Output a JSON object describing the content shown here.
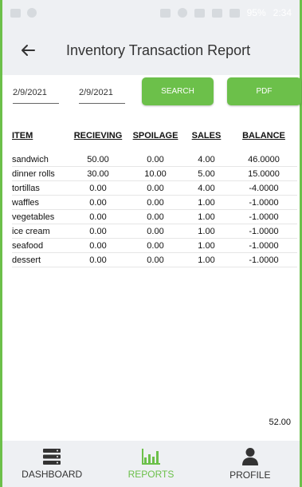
{
  "status_bar": {
    "battery": "95%",
    "time": "2:34"
  },
  "header": {
    "title": "Inventory Transaction Report"
  },
  "filters": {
    "date_from": "2/9/2021",
    "date_to": "2/9/2021",
    "search_label": "SEARCH",
    "pdf_label": "PDF"
  },
  "report": {
    "columns": [
      "ITEM",
      "RECIEVING",
      "SPOILAGE",
      "SALES",
      "BALANCE"
    ],
    "rows": [
      {
        "item": "sandwich",
        "recieving": "50.00",
        "spoilage": "0.00",
        "sales": "4.00",
        "balance": "46.0000"
      },
      {
        "item": "dinner rolls",
        "recieving": "30.00",
        "spoilage": "10.00",
        "sales": "5.00",
        "balance": "15.0000"
      },
      {
        "item": "tortillas",
        "recieving": "0.00",
        "spoilage": "0.00",
        "sales": "4.00",
        "balance": "-4.0000"
      },
      {
        "item": "waffles",
        "recieving": "0.00",
        "spoilage": "0.00",
        "sales": "1.00",
        "balance": "-1.0000"
      },
      {
        "item": "vegetables",
        "recieving": "0.00",
        "spoilage": "0.00",
        "sales": "1.00",
        "balance": "-1.0000"
      },
      {
        "item": "ice cream",
        "recieving": "0.00",
        "spoilage": "0.00",
        "sales": "1.00",
        "balance": "-1.0000"
      },
      {
        "item": "seafood",
        "recieving": "0.00",
        "spoilage": "0.00",
        "sales": "1.00",
        "balance": "-1.0000"
      },
      {
        "item": "dessert",
        "recieving": "0.00",
        "spoilage": "0.00",
        "sales": "1.00",
        "balance": "-1.0000"
      }
    ],
    "total": "52.00"
  },
  "bottom_nav": {
    "items": [
      {
        "label": "DASHBOARD",
        "icon": "dashboard-icon"
      },
      {
        "label": "REPORTS",
        "icon": "bar-chart-icon"
      },
      {
        "label": "PROFILE",
        "icon": "person-icon"
      }
    ],
    "active_index": 1
  },
  "colors": {
    "accent": "#6cc04a",
    "bar_background": "#eef0f3"
  }
}
